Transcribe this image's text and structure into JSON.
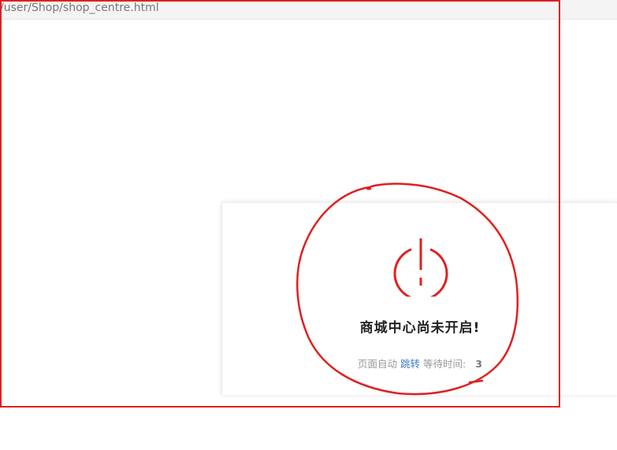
{
  "browser": {
    "url": "/user/Shop/shop_centre.html"
  },
  "notice": {
    "icon": "power-icon",
    "title": "商城中心尚未开启!",
    "auto_text": "页面自动",
    "jump_link": "跳转",
    "wait_text": "等待时间:",
    "countdown": "3"
  },
  "colors": {
    "annotation": "#e02020",
    "icon": "#e02020",
    "link": "#3b7cc4",
    "muted_text": "#999999",
    "title_text": "#222222"
  }
}
